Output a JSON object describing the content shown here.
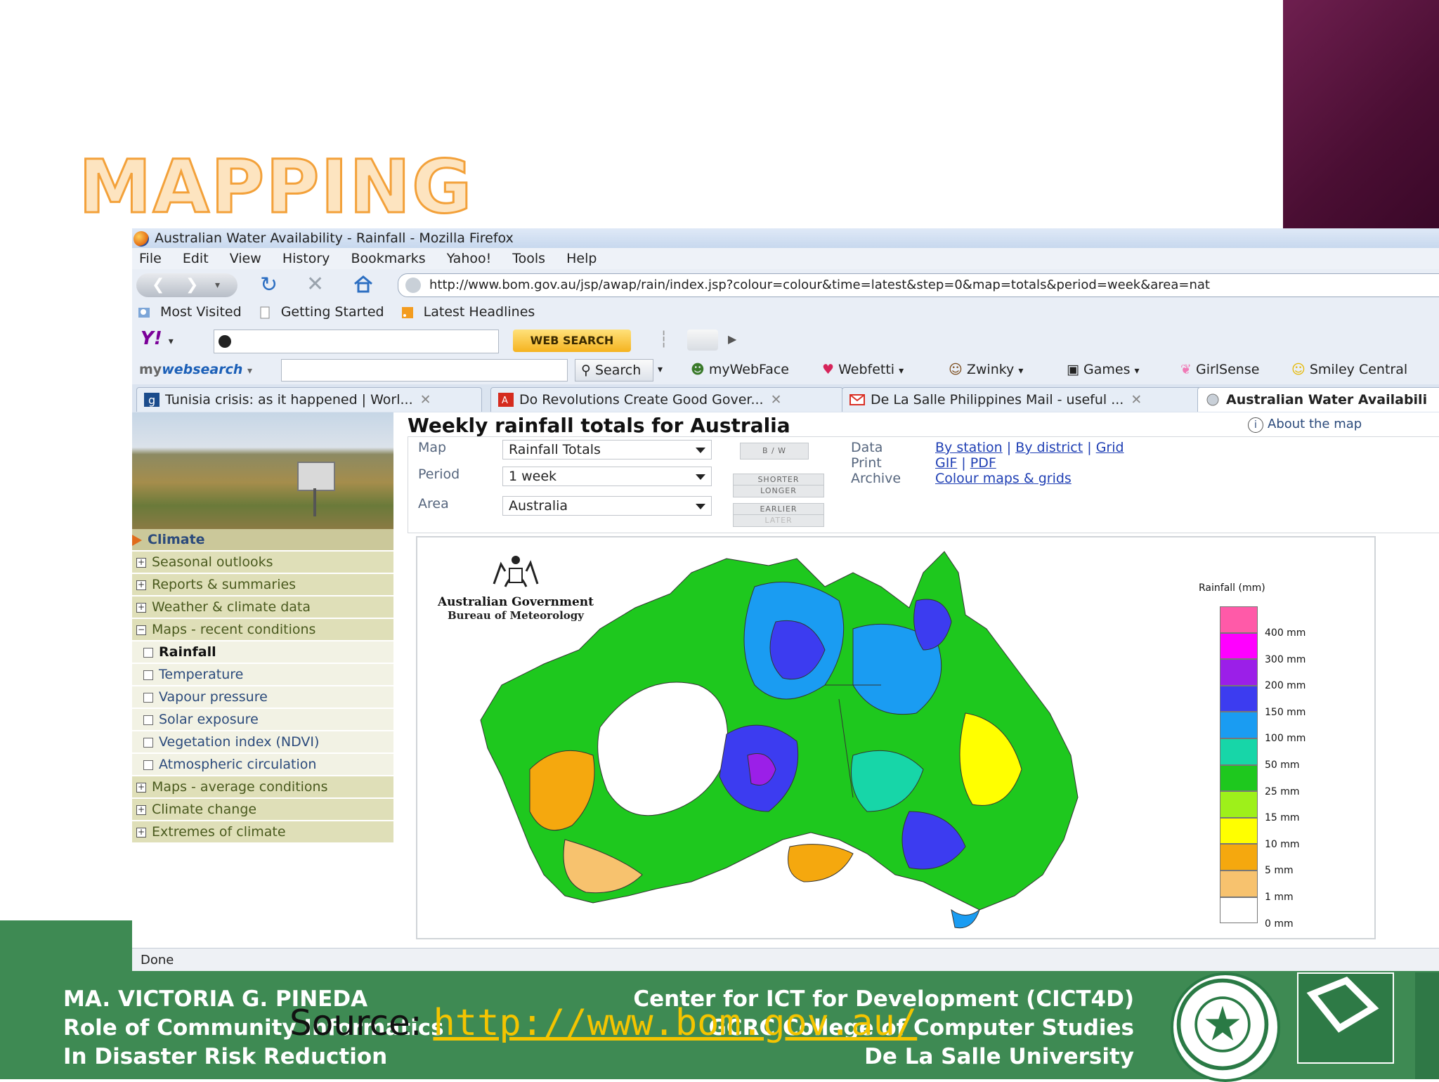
{
  "slide": {
    "title": "MAPPING",
    "source_label": "Source: ",
    "source_url": "http://www.bom.gov.au/",
    "footer_left": [
      "MA. VICTORIA G. PINEDA",
      "Role of Community Informatics",
      "In Disaster Risk Reduction"
    ],
    "footer_right": [
      "Center for ICT for Development (CICT4D)",
      "GCRC College of Computer Studies",
      "De La Salle University"
    ]
  },
  "browser": {
    "window_title": "Australian Water Availability - Rainfall - Mozilla Firefox",
    "menu": [
      "File",
      "Edit",
      "View",
      "History",
      "Bookmarks",
      "Yahoo!",
      "Tools",
      "Help"
    ],
    "url": "http://www.bom.gov.au/jsp/awap/rain/index.jsp?colour=colour&time=latest&step=0&map=totals&period=week&area=nat",
    "bookmarks": [
      "Most Visited",
      "Getting Started",
      "Latest Headlines"
    ],
    "yahoo_logo": "Y!",
    "web_search_label": "WEB SEARCH",
    "mywebsearch_prefix": "my",
    "mywebsearch_brand": "websearch",
    "search_label": "Search",
    "toolbar_items": [
      "myWebFace",
      "Webfetti",
      "Zwinky",
      "Games",
      "GirlSense",
      "Smiley Central"
    ],
    "tabs": [
      {
        "label": "Tunisia crisis: as it happened | Worl...",
        "active": false
      },
      {
        "label": "Do Revolutions Create Good Gover...",
        "active": false
      },
      {
        "label": "De La Salle Philippines Mail - useful ...",
        "active": false
      },
      {
        "label": "Australian Water Availabili",
        "active": true
      }
    ],
    "status": "Done"
  },
  "sidebar": {
    "heading": "Climate",
    "sections": [
      {
        "label": "Seasonal outlooks",
        "expanded": false
      },
      {
        "label": "Reports & summaries",
        "expanded": false
      },
      {
        "label": "Weather & climate data",
        "expanded": false
      },
      {
        "label": "Maps - recent conditions",
        "expanded": true
      }
    ],
    "subitems": [
      {
        "label": "Rainfall",
        "selected": true
      },
      {
        "label": "Temperature",
        "selected": false
      },
      {
        "label": "Vapour pressure",
        "selected": false
      },
      {
        "label": "Solar exposure",
        "selected": false
      },
      {
        "label": "Vegetation index (NDVI)",
        "selected": false
      },
      {
        "label": "Atmospheric circulation",
        "selected": false
      }
    ],
    "more_sections": [
      "Maps - average conditions",
      "Climate change",
      "Extremes of climate"
    ]
  },
  "page": {
    "title": "Weekly rainfall totals for Australia",
    "about_link": "About the map",
    "form": {
      "map_label": "Map",
      "map_value": "Rainfall Totals",
      "period_label": "Period",
      "period_value": "1 week",
      "area_label": "Area",
      "area_value": "Australia",
      "bw_button": "B / W",
      "shorter_button": "SHORTER",
      "longer_button": "LONGER",
      "earlier_button": "EARLIER",
      "later_button": "LATER",
      "data_label": "Data",
      "print_label": "Print",
      "archive_label": "Archive",
      "data_links": [
        "By station",
        "By district",
        "Grid"
      ],
      "link_separator": " | ",
      "print_links": [
        "GIF",
        "PDF"
      ],
      "archive_link": "Colour maps & grids"
    },
    "map": {
      "govt_line1": "Australian Government",
      "govt_line2": "Bureau of Meteorology",
      "legend_title": "Rainfall (mm)",
      "legend": [
        {
          "label": "400 mm",
          "color": "#ff5aa8"
        },
        {
          "label": "300 mm",
          "color": "#ff00ff"
        },
        {
          "label": "200 mm",
          "color": "#9b1fe8"
        },
        {
          "label": "150 mm",
          "color": "#3c3cf0"
        },
        {
          "label": "100 mm",
          "color": "#1a9cf2"
        },
        {
          "label": "50 mm",
          "color": "#17d6a8"
        },
        {
          "label": "25 mm",
          "color": "#1ec81e"
        },
        {
          "label": "15 mm",
          "color": "#9ef01a"
        },
        {
          "label": "10 mm",
          "color": "#ffff00"
        },
        {
          "label": "5 mm",
          "color": "#f5a80e"
        },
        {
          "label": "1 mm",
          "color": "#f7c26e"
        },
        {
          "label": "0 mm",
          "color": "#ffffff"
        }
      ]
    }
  }
}
